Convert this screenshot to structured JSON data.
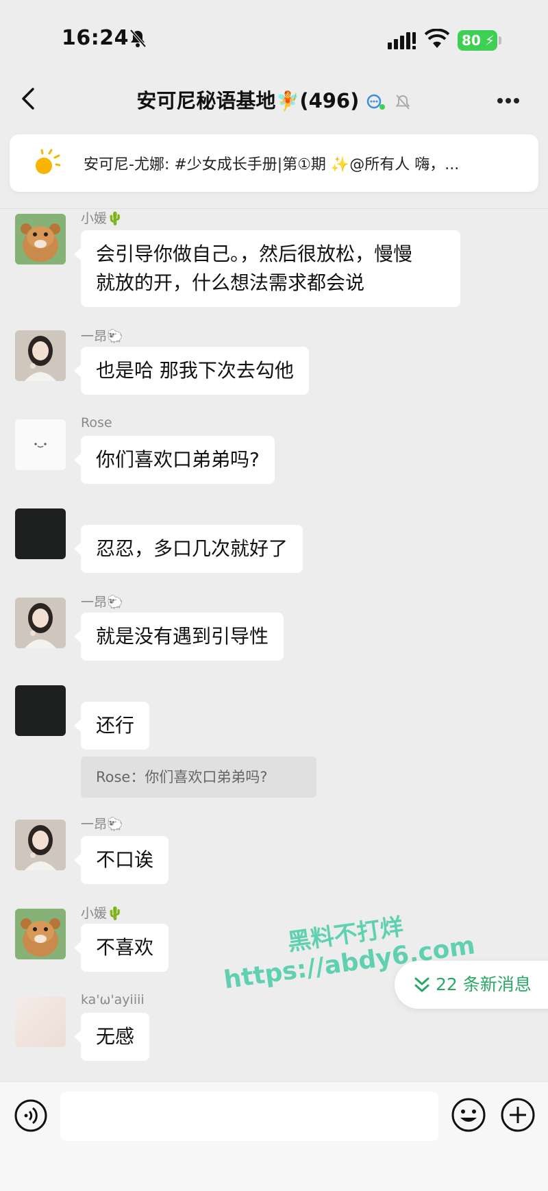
{
  "status_bar": {
    "time": "16:24",
    "battery": "80"
  },
  "header": {
    "title": "安可尼秘语基地",
    "title_emoji": "🧚",
    "member_count": "(496)"
  },
  "pinned_notice": {
    "text": "安可尼-尤娜: #少女成长手册|第①期 ✨@所有人  嗨，..."
  },
  "messages": [
    {
      "sender": "小媛🌵",
      "avatar": "bear",
      "lines": [
        "会引导你做自己。，然后很放松，慢慢",
        "就放的开，什么想法需求都会说"
      ]
    },
    {
      "sender": "一昂🐑",
      "avatar": "girl",
      "lines": [
        "也是哈 那我下次去勾他"
      ]
    },
    {
      "sender": "Rose",
      "avatar": "rose",
      "lines": [
        "你们喜欢口弟弟吗?"
      ]
    },
    {
      "sender": "",
      "avatar": "black",
      "lines": [
        "忍忍，多口几次就好了"
      ]
    },
    {
      "sender": "一昂🐑",
      "avatar": "girl",
      "lines": [
        "就是没有遇到引导性"
      ]
    },
    {
      "sender": "",
      "avatar": "black",
      "lines": [
        "还行"
      ],
      "quote": "Rose：你们喜欢口弟弟吗?"
    },
    {
      "sender": "一昂🐑",
      "avatar": "girl",
      "lines": [
        "不口诶"
      ]
    },
    {
      "sender": "小媛🌵",
      "avatar": "bear",
      "lines": [
        "不喜欢"
      ]
    },
    {
      "sender": "ka'ω'ayiiii",
      "avatar": "pale",
      "lines": [
        "无感"
      ]
    }
  ],
  "new_messages": {
    "label": "22 条新消息"
  },
  "watermark": {
    "line1": "黑料不打烊",
    "line2": "https://abdy6.com"
  },
  "colors": {
    "background": "#ededed",
    "bubble": "#ffffff",
    "accent_green": "#2aa865",
    "battery_green": "#3fcf53"
  }
}
